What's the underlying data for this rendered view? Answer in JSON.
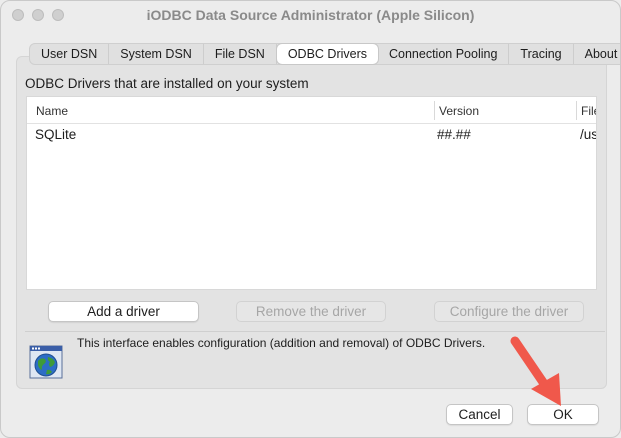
{
  "window": {
    "title": "iODBC Data Source Administrator (Apple Silicon)"
  },
  "tabs": [
    {
      "label": "User DSN",
      "active": false
    },
    {
      "label": "System DSN",
      "active": false
    },
    {
      "label": "File DSN",
      "active": false
    },
    {
      "label": "ODBC Drivers",
      "active": true
    },
    {
      "label": "Connection Pooling",
      "active": false
    },
    {
      "label": "Tracing",
      "active": false
    },
    {
      "label": "About",
      "active": false
    }
  ],
  "drivers": {
    "section_label": "ODBC Drivers that are installed on your system",
    "columns": [
      "Name",
      "Version",
      "File"
    ],
    "rows": [
      {
        "name": "SQLite",
        "version": "##.##",
        "file": "/us"
      }
    ]
  },
  "actions": {
    "add": "Add a driver",
    "remove": "Remove the driver",
    "configure": "Configure the driver"
  },
  "info": {
    "text": "This interface enables configuration (addition and removal) of ODBC Drivers.",
    "icon": "globe-window-icon"
  },
  "footer": {
    "cancel": "Cancel",
    "ok": "OK"
  },
  "colors": {
    "annotation_arrow": "#f0584b"
  }
}
